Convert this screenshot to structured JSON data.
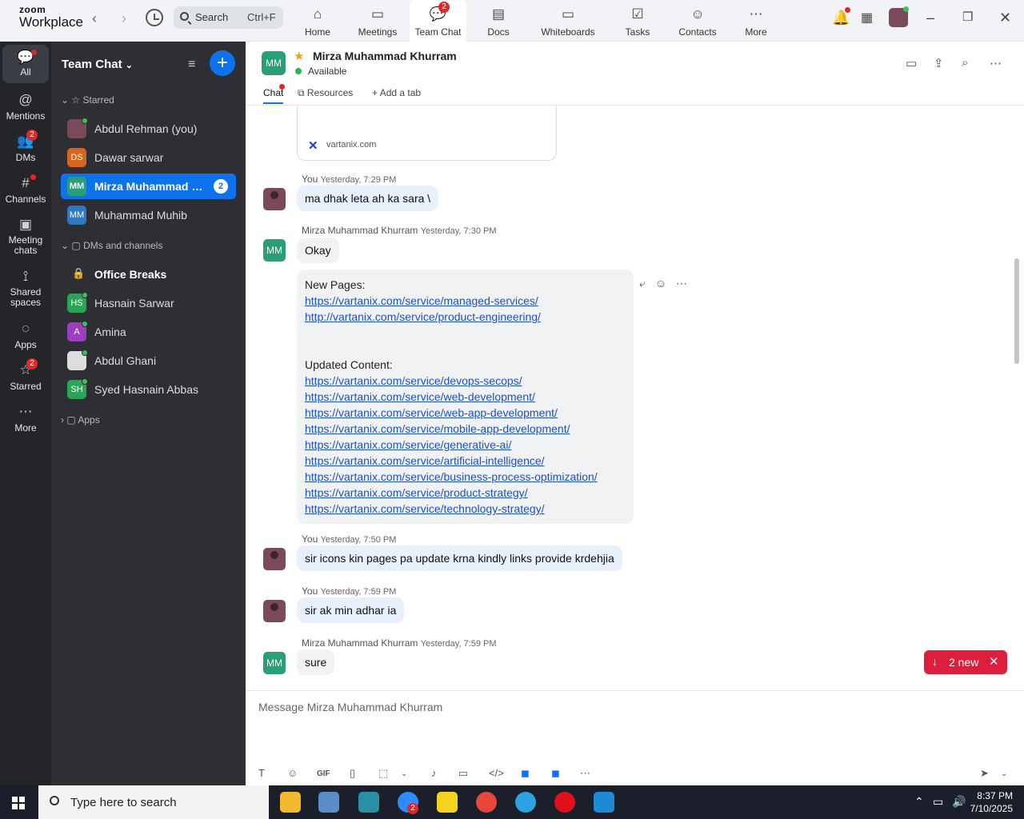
{
  "app": {
    "brand_top": "zoom",
    "brand_bottom": "Workplace"
  },
  "search": {
    "label": "Search",
    "shortcut": "Ctrl+F"
  },
  "topnav": [
    {
      "label": "Home",
      "icon": "home-icon"
    },
    {
      "label": "Meetings",
      "icon": "video-icon"
    },
    {
      "label": "Team Chat",
      "icon": "chat-icon",
      "badge": "2"
    },
    {
      "label": "Docs",
      "icon": "doc-icon"
    },
    {
      "label": "Whiteboards",
      "icon": "whiteboard-icon"
    },
    {
      "label": "Tasks",
      "icon": "tasks-icon"
    },
    {
      "label": "Contacts",
      "icon": "contacts-icon"
    },
    {
      "label": "More",
      "icon": "more-icon"
    }
  ],
  "leftnav": [
    {
      "label": "All"
    },
    {
      "label": "Mentions"
    },
    {
      "label": "DMs",
      "badge": "2"
    },
    {
      "label": "Channels"
    },
    {
      "label": "Meeting chats"
    },
    {
      "label": "Shared spaces"
    },
    {
      "label": "Apps"
    },
    {
      "label": "Starred",
      "badge": "2"
    },
    {
      "label": "More"
    }
  ],
  "sidebar": {
    "title": "Team Chat",
    "starred_label": "Starred",
    "dms_label": "DMs and channels",
    "apps_label": "Apps",
    "starred": [
      {
        "name": "Abdul Rehman (you)",
        "initials": ""
      },
      {
        "name": "Dawar sarwar",
        "initials": "DS"
      },
      {
        "name": "Mirza Muhammad Khurram",
        "initials": "MM",
        "count": "2"
      },
      {
        "name": "Muhammad Muhib",
        "initials": "MM"
      }
    ],
    "dms": [
      {
        "name": "Office Breaks",
        "initials": ""
      },
      {
        "name": "Hasnain Sarwar",
        "initials": "HS"
      },
      {
        "name": "Amina",
        "initials": "A"
      },
      {
        "name": "Abdul Ghani",
        "initials": ""
      },
      {
        "name": "Syed Hasnain Abbas",
        "initials": "SH"
      }
    ]
  },
  "chat": {
    "initials": "MM",
    "name": "Mirza Muhammad Khurram",
    "status": "Available",
    "tabs": [
      "Chat",
      "Resources",
      "Add a tab"
    ],
    "preview_url": "vartanix.com",
    "composer_placeholder": "Message Mirza Muhammad Khurram",
    "new_label": "2 new"
  },
  "messages": [
    {
      "sender": "You",
      "time": "Yesterday, 7:29 PM",
      "text": "ma dhak leta ah ka sara \\"
    },
    {
      "sender": "Mirza Muhammad Khurram",
      "time": "Yesterday, 7:30 PM",
      "text": "Okay"
    },
    {
      "sender": "You",
      "time": "Yesterday, 7:50 PM",
      "text": "sir icons  kin pages pa update krna kindly links provide krdehjia"
    },
    {
      "sender": "You",
      "time": "Yesterday, 7:59 PM",
      "text": "sir ak min adhar ia"
    },
    {
      "sender": "Mirza Muhammad Khurram",
      "time": "Yesterday, 7:59 PM",
      "text": "sure"
    }
  ],
  "links_message": {
    "heading1": "New Pages:",
    "new_pages": [
      "https://vartanix.com/service/managed-services/",
      "http://vartanix.com/service/product-engineering/"
    ],
    "heading2": "Updated Content:",
    "updated": [
      "https://vartanix.com/service/devops-secops/",
      "https://vartanix.com/service/web-development/",
      "https://vartanix.com/service/web-app-development/",
      "https://vartanix.com/service/mobile-app-development/",
      "https://vartanix.com/service/generative-ai/",
      "https://vartanix.com/service/artificial-intelligence/",
      "https://vartanix.com/service/business-process-optimization/",
      "https://vartanix.com/service/product-strategy/",
      "https://vartanix.com/service/technology-strategy/"
    ]
  },
  "taskbar": {
    "search_placeholder": "Type here to search",
    "time": "8:37 PM",
    "date": "7/10/2025",
    "zoom_badge": "2"
  },
  "colors": {
    "accent": "#0e72ed",
    "sidebar_bg": "#2d2f34",
    "nav_bg": "#232529",
    "new_pill": "#dc1f3c"
  }
}
